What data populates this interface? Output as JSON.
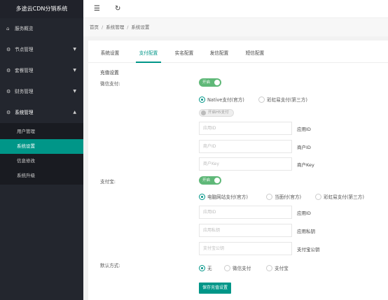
{
  "brand": "多途云CDN分销系统",
  "sidebar": {
    "items": [
      {
        "label": "服务概览",
        "icon": "home-icon"
      },
      {
        "label": "节点管理",
        "icon": "gear-icon"
      },
      {
        "label": "套餐管理",
        "icon": "gear-icon"
      },
      {
        "label": "财务管理",
        "icon": "gear-icon"
      },
      {
        "label": "系统管理",
        "icon": "gear-icon"
      }
    ],
    "sub_items": [
      "用户管理",
      "系统设置",
      "信息修改",
      "系统升级"
    ]
  },
  "header": {
    "menu_icon": "☰",
    "refresh_icon": "↻"
  },
  "breadcrumb": [
    "首页",
    "系统管理",
    "系统设置"
  ],
  "tabs": [
    "系统设置",
    "支付配置",
    "实名配置",
    "发信配置",
    "短信配置"
  ],
  "form": {
    "section_title": "充值设置",
    "wechat": {
      "label": "微信支付:",
      "switch_label": "开启",
      "options": [
        "Native支付(官方)",
        "彩虹易支付(第三方)"
      ],
      "sub_switch_label": "开启H5支付",
      "fields": [
        {
          "placeholder": "应用ID",
          "label": "应用ID"
        },
        {
          "placeholder": "商户ID",
          "label": "商户ID"
        },
        {
          "placeholder": "商户Key",
          "label": "商户Key"
        }
      ]
    },
    "alipay": {
      "label": "支付宝:",
      "switch_label": "开启",
      "options": [
        "电脑网站支付(官方)",
        "当面付(官方)",
        "彩虹易支付(第三方)"
      ],
      "fields": [
        {
          "placeholder": "应用ID",
          "label": "应用ID"
        },
        {
          "placeholder": "应用私钥",
          "label": "应用私钥"
        },
        {
          "placeholder": "支付宝公钥",
          "label": "支付宝公钥"
        }
      ]
    },
    "default_method": {
      "label": "默认方式:",
      "options": [
        "无",
        "微信支付",
        "支付宝"
      ]
    },
    "save_button": "保存充值设置"
  },
  "colors": {
    "accent": "#009688",
    "switch_on": "#5fb878",
    "sidebar": "#23262e"
  }
}
